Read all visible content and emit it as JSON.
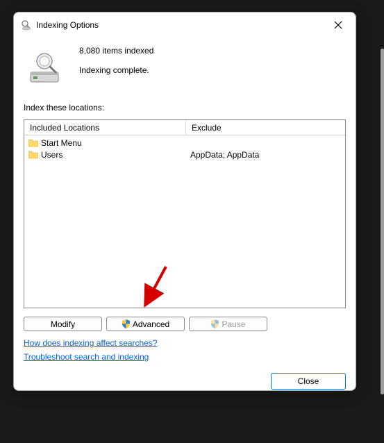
{
  "title": "Indexing Options",
  "status": {
    "count": "8,080 items indexed",
    "message": "Indexing complete."
  },
  "section_label": "Index these locations:",
  "columns": {
    "included": "Included Locations",
    "exclude": "Exclude"
  },
  "locations": [
    {
      "name": "Start Menu",
      "exclude": ""
    },
    {
      "name": "Users",
      "exclude": "AppData; AppData"
    }
  ],
  "buttons": {
    "modify": "Modify",
    "advanced": "Advanced",
    "pause": "Pause",
    "close": "Close"
  },
  "links": {
    "how": "How does indexing affect searches?",
    "troubleshoot": "Troubleshoot search and indexing"
  }
}
